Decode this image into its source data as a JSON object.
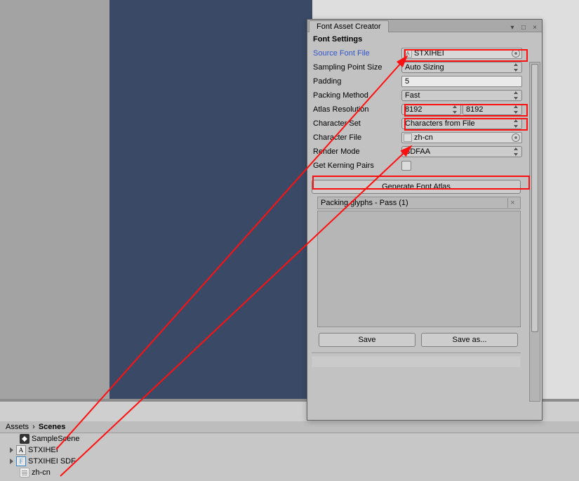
{
  "window": {
    "title": "Font Asset Creator",
    "section": "Font Settings",
    "controls": {
      "opts": "▾",
      "min": "□",
      "close": "×"
    }
  },
  "fields": {
    "source_font_label": "Source Font File",
    "source_font_value": "STXIHEI",
    "sampling_label": "Sampling Point Size",
    "sampling_value": "Auto Sizing",
    "padding_label": "Padding",
    "padding_value": "5",
    "packing_label": "Packing Method",
    "packing_value": "Fast",
    "atlas_label": "Atlas Resolution",
    "atlas_w": "8192",
    "atlas_h": "8192",
    "charset_label": "Character Set",
    "charset_value": "Characters from File",
    "charfile_label": "Character File",
    "charfile_value": "zh-cn",
    "render_label": "Render Mode",
    "render_value": "SDFAA",
    "kerning_label": "Get Kerning Pairs"
  },
  "buttons": {
    "generate": "Generate Font Atlas",
    "save": "Save",
    "save_as": "Save as..."
  },
  "status": "Packing glyphs - Pass (1)",
  "breadcrumb": {
    "p1": "Assets",
    "p2": "Scenes"
  },
  "tree": {
    "samplescene": "SampleScene",
    "stxihei": "STXIHEI",
    "stxihei_sdf": "STXIHEI SDF",
    "zhcn": "zh-cn"
  },
  "glyphs": {
    "font_a": "A",
    "font_f": "F"
  }
}
